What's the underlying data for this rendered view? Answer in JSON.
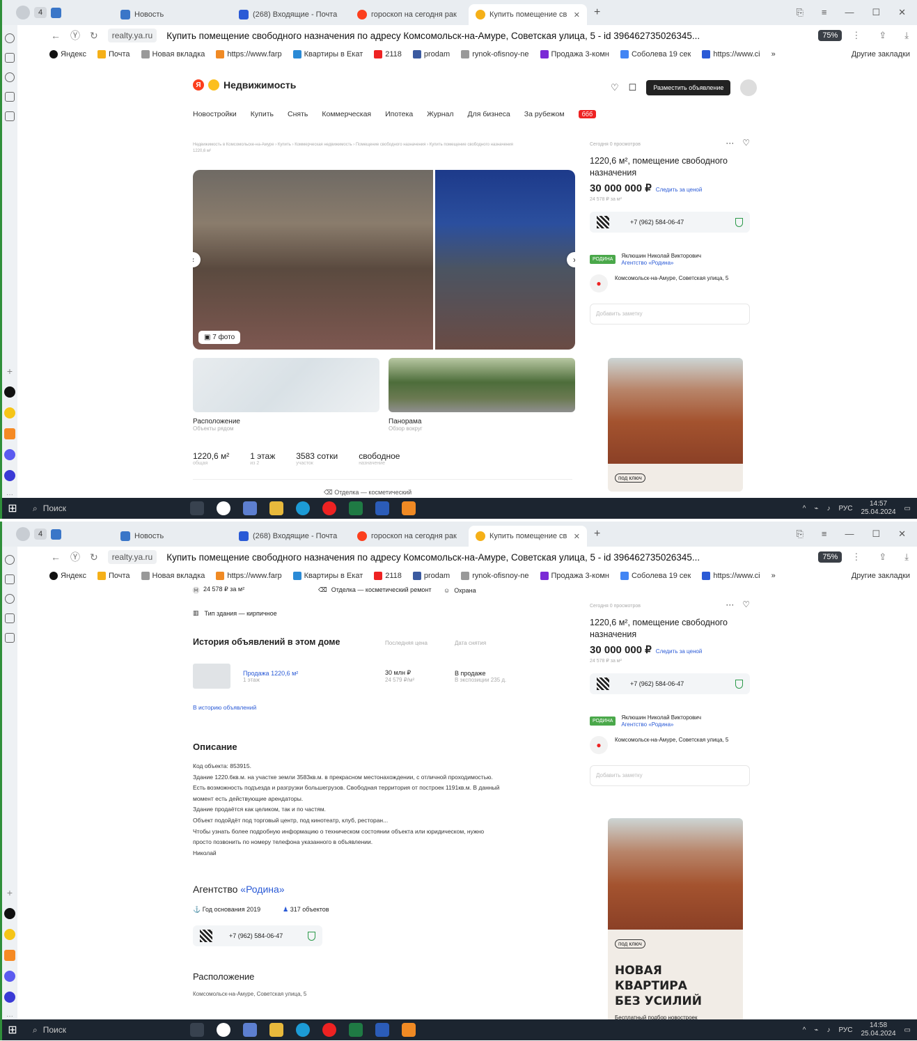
{
  "browser": {
    "tab_count": "4",
    "tabs": [
      {
        "label": "Новость",
        "color": "#3a76c8"
      },
      {
        "label": "(268) Входящие - Почта",
        "color": "#2a5ad6"
      },
      {
        "label": "гороскоп на сегодня рак",
        "color": "#fc3f1d"
      },
      {
        "label": "Купить помещение св",
        "color": "#f5b018"
      }
    ],
    "active_tab_index": 3,
    "url_host": "realty.ya.ru",
    "page_title": "Купить помещение свободного назначения по адресу Комсомольск-на-Амуре, Советская улица, 5 - id 396462735026345...",
    "zoom": "75%",
    "bookmarks": [
      {
        "label": "Яндекс",
        "color": "#111"
      },
      {
        "label": "Почта",
        "color": "#f5b018"
      },
      {
        "label": "Новая вкладка",
        "color": "#999"
      },
      {
        "label": "https://www.farp",
        "color": "#f08a24"
      },
      {
        "label": "Квартиры в Екат",
        "color": "#2a8ad6"
      },
      {
        "label": "2118",
        "color": "#e22"
      },
      {
        "label": "prodam",
        "color": "#3a5aa0"
      },
      {
        "label": "rynok-ofisnoy-ne",
        "color": "#999"
      },
      {
        "label": "Продажа 3-комн",
        "color": "#7a2ad6"
      },
      {
        "label": "Соболева 19 сек",
        "color": "#4285f4"
      },
      {
        "label": "https://www.ci",
        "color": "#2a5ad6"
      }
    ],
    "bookmarks_more": "»",
    "other_bookmarks": "Другие закладки"
  },
  "site": {
    "brand": "Недвижимость",
    "post_button": "Разместить объявление",
    "menu": [
      "Новостройки",
      "Купить",
      "Снять",
      "Коммерческая",
      "Ипотека",
      "Журнал",
      "Для бизнеса",
      "За рубежом"
    ],
    "menu_badge": "ббб"
  },
  "listing": {
    "breadcrumbs": "Недвижимость в Комсомольске-на-Амуре › Купить › Коммерческая недвижимость › Помещение свободного назначения › Купить помещение свободного назначения 1220,6 м²",
    "views": "Сегодня 0 просмотров",
    "title": "1220,6 м², помещение свободного назначения",
    "price": "30 000 000 ₽",
    "follow_price": "Следить за ценой",
    "price_per_m": "24 578 ₽ за м²",
    "phone": "+7 (962) 584-06-47",
    "agency_badge": "РОДИНА",
    "agent_name": "Яклюшин Николай Викторович",
    "agent_org": "Агентство «Родина»",
    "address": "Комсомольск-на-Амуре, Советская улица, 5",
    "note_placeholder": "Добавить заметку",
    "photo_count": "7 фото",
    "map_title": "Расположение",
    "map_sub": "Объекты рядом",
    "pano_title": "Панорама",
    "pano_sub": "Обзор вокруг",
    "specs": [
      {
        "value": "1220,6 м²",
        "label": "общая"
      },
      {
        "value": "1 этаж",
        "label": "из 2"
      },
      {
        "value": "3583 сотки",
        "label": "участок"
      },
      {
        "value": "свободное",
        "label": "назначение"
      }
    ],
    "bottom_peek": "Отделка — косметический"
  },
  "details": {
    "price_per_m": "24 578 ₽ за м²",
    "finish": "Отделка — косметический ремонт",
    "security": "Охрана",
    "building_type": "Тип здания — кирпичное",
    "history_title": "История объявлений в этом доме",
    "history_col_price": "Последняя цена",
    "history_col_date": "Дата снятия",
    "history_item_title": "Продажа 1220,6 м²",
    "history_item_floor": "1 этаж",
    "history_item_price": "30 млн ₽",
    "history_item_ppm": "24 579 ₽/м²",
    "history_item_status": "В продаже",
    "history_item_exposure": "В экспозиции 235 д.",
    "history_link": "В историю объявлений",
    "description_title": "Описание",
    "description": [
      "Код объекта: 853915.",
      "Здание 1220.6кв.м. на участке земли 3583кв.м. в прекрасном местонахождении, с отличной проходимостью.",
      "Есть возможность подъезда и разгрузки большегрузов. Свободная территория от построек 1191кв.м. В данный",
      "момент есть действующие арендаторы.",
      "Здание продаётся как целиком, так и по частям.",
      "Объект подойдёт под торговый центр, под кинотеатр, клуб, ресторан...",
      "Чтобы узнать более подробную информацию о техническом состоянии объекта или юридическом, нужно",
      "просто позвонить по номеру телефона указанного в объявлении.",
      "Николай"
    ],
    "agency_prefix": "Агентство ",
    "agency_name": "«Родина»",
    "agency_founded": "Год основания 2019",
    "agency_objects": "317 объектов",
    "location_title": "Расположение",
    "location_address": "Комсомольск-на-Амуре, Советская улица, 5"
  },
  "ad": {
    "tag": "под ключ",
    "headline_1": "НОВАЯ КВАРТИРА",
    "headline_2": "БЕЗ УСИЛИЙ",
    "sub": "Бесплатный подбор новостроек"
  },
  "taskbar": {
    "search": "Поиск",
    "lang": "РУС",
    "time_1": "14:57",
    "time_2": "14:58",
    "date": "25.04.2024"
  }
}
